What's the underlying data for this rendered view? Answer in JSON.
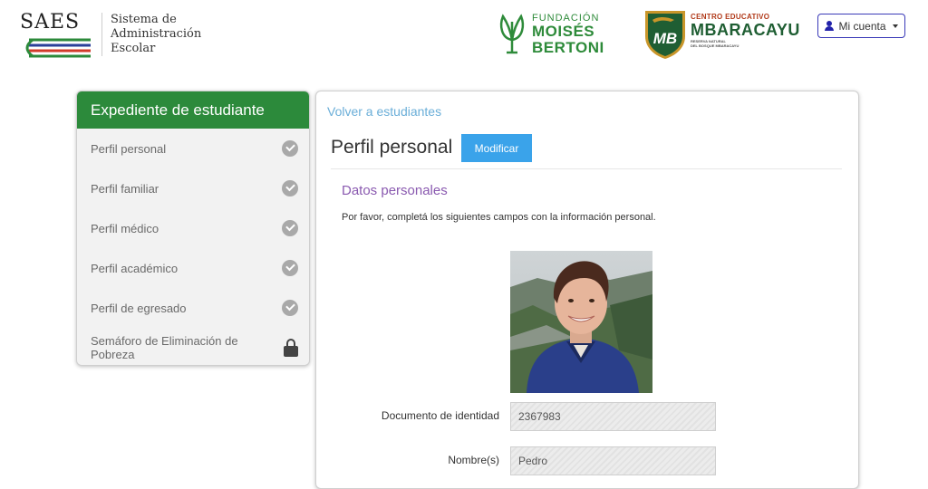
{
  "header": {
    "logo_title": "SAES",
    "logo_subtitle_lines": [
      "Sistema de",
      "Administración",
      "Escolar"
    ],
    "fmb_lines": [
      "FUNDACIÓN",
      "MOISÉS",
      "BERTONI"
    ],
    "mb_shield_text": "MB",
    "mb_lines": [
      "CENTRO EDUCATIVO",
      "MBARACAYU",
      "RESERVA NATURAL",
      "DEL BOSQUE MBARACAYU"
    ],
    "account_label": "Mi cuenta"
  },
  "sidebar": {
    "title": "Expediente de estudiante",
    "items": [
      {
        "label": "Perfil personal",
        "icon": "check-circle-icon"
      },
      {
        "label": "Perfil familiar",
        "icon": "check-circle-icon"
      },
      {
        "label": "Perfil médico",
        "icon": "check-circle-icon"
      },
      {
        "label": "Perfil académico",
        "icon": "check-circle-icon"
      },
      {
        "label": "Perfil de egresado",
        "icon": "check-circle-icon"
      },
      {
        "label": "Semáforo de Eliminación de Pobreza",
        "icon": "lock-icon"
      }
    ]
  },
  "main": {
    "back_link": "Volver a estudiantes",
    "title": "Perfil personal",
    "modify_label": "Modificar",
    "section_title": "Datos personales",
    "section_desc": "Por favor, completá los siguientes campos con la información personal.",
    "fields": [
      {
        "label": "Documento de identidad",
        "value": "2367983"
      },
      {
        "label": "Nombre(s)",
        "value": "Pedro"
      }
    ]
  },
  "colors": {
    "sidebar_header": "#2c8a3b",
    "modify_button": "#3aa3ea",
    "section_title": "#8a5ab0",
    "link": "#6aaed8"
  }
}
